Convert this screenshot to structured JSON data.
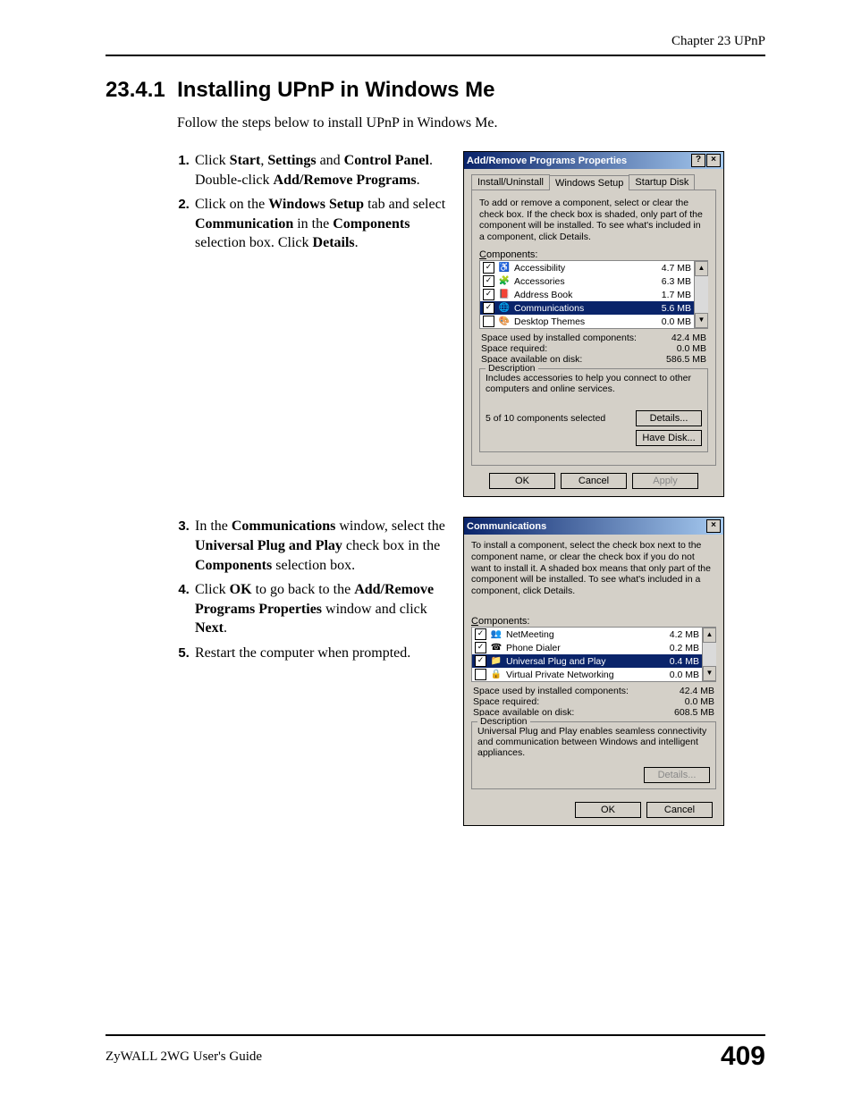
{
  "header": {
    "chapter": "Chapter 23 UPnP"
  },
  "section": {
    "number": "23.4.1",
    "title": "Installing UPnP in Windows Me"
  },
  "intro": "Follow the steps below to install UPnP in Windows Me.",
  "steps1": [
    {
      "pre": "Click ",
      "b1": "Start",
      "mid1": ", ",
      "b2": "Settings",
      "mid2": " and ",
      "b3": "Control Panel",
      "mid3": ". Double-click ",
      "b4": "Add/Remove Programs",
      "post": "."
    },
    {
      "pre": "Click on the ",
      "b1": "Windows Setup",
      "mid1": " tab and select ",
      "b2": "Communication",
      "mid2": " in the ",
      "b3": "Components",
      "mid3": " selection box. Click ",
      "b4": "Details",
      "post": "."
    }
  ],
  "steps2": [
    {
      "pre": "In the ",
      "b1": "Communications",
      "mid1": " window, select the ",
      "b2": "Universal Plug and Play",
      "mid2": " check box in the ",
      "b3": "Components",
      "post": " selection box."
    },
    {
      "pre": "Click ",
      "b1": "OK",
      "mid1": " to go back to the ",
      "b2": "Add/Remove Programs Properties",
      "mid2": " window and click ",
      "b3": "Next",
      "post": "."
    },
    {
      "pre": "Restart the computer when prompted."
    }
  ],
  "dlg1": {
    "title": "Add/Remove Programs Properties",
    "tabs": [
      "Install/Uninstall",
      "Windows Setup",
      "Startup Disk"
    ],
    "instruction": "To add or remove a component, select or clear the check box. If the check box is shaded, only part of the component will be installed. To see what's included in a component, click Details.",
    "components_label": "Components:",
    "items": [
      {
        "checked": true,
        "icon": "♿",
        "name": "Accessibility",
        "size": "4.7 MB",
        "selected": false
      },
      {
        "checked": true,
        "icon": "🧩",
        "name": "Accessories",
        "size": "6.3 MB",
        "selected": false
      },
      {
        "checked": true,
        "icon": "📕",
        "name": "Address Book",
        "size": "1.7 MB",
        "selected": false
      },
      {
        "checked": true,
        "icon": "🌐",
        "name": "Communications",
        "size": "5.6 MB",
        "selected": true
      },
      {
        "checked": false,
        "icon": "🎨",
        "name": "Desktop Themes",
        "size": "0.0 MB",
        "selected": false
      }
    ],
    "space_used_label": "Space used by installed components:",
    "space_used": "42.4 MB",
    "space_req_label": "Space required:",
    "space_req": "0.0 MB",
    "space_avail_label": "Space available on disk:",
    "space_avail": "586.5 MB",
    "desc_label": "Description",
    "desc": "Includes accessories to help you connect to other computers and online services.",
    "selected_count": "5 of 10 components selected",
    "details_btn": "Details...",
    "havedisk_btn": "Have Disk...",
    "ok": "OK",
    "cancel": "Cancel",
    "apply": "Apply"
  },
  "dlg2": {
    "title": "Communications",
    "instruction": "To install a component, select the check box next to the component name, or clear the check box if you do not want to install it. A shaded box means that only part of the component will be installed. To see what's included in a component, click Details.",
    "components_label": "Components:",
    "items": [
      {
        "checked": true,
        "icon": "👥",
        "name": "NetMeeting",
        "size": "4.2 MB",
        "selected": false
      },
      {
        "checked": true,
        "icon": "☎",
        "name": "Phone Dialer",
        "size": "0.2 MB",
        "selected": false
      },
      {
        "checked": true,
        "icon": "📁",
        "name": "Universal Plug and Play",
        "size": "0.4 MB",
        "selected": true
      },
      {
        "checked": false,
        "icon": "🔒",
        "name": "Virtual Private Networking",
        "size": "0.0 MB",
        "selected": false
      }
    ],
    "space_used_label": "Space used by installed components:",
    "space_used": "42.4 MB",
    "space_req_label": "Space required:",
    "space_req": "0.0 MB",
    "space_avail_label": "Space available on disk:",
    "space_avail": "608.5 MB",
    "desc_label": "Description",
    "desc": "Universal Plug and Play enables seamless connectivity and communication between Windows and intelligent appliances.",
    "details_btn": "Details...",
    "ok": "OK",
    "cancel": "Cancel"
  },
  "footer": {
    "guide": "ZyWALL 2WG User's Guide",
    "page": "409"
  }
}
